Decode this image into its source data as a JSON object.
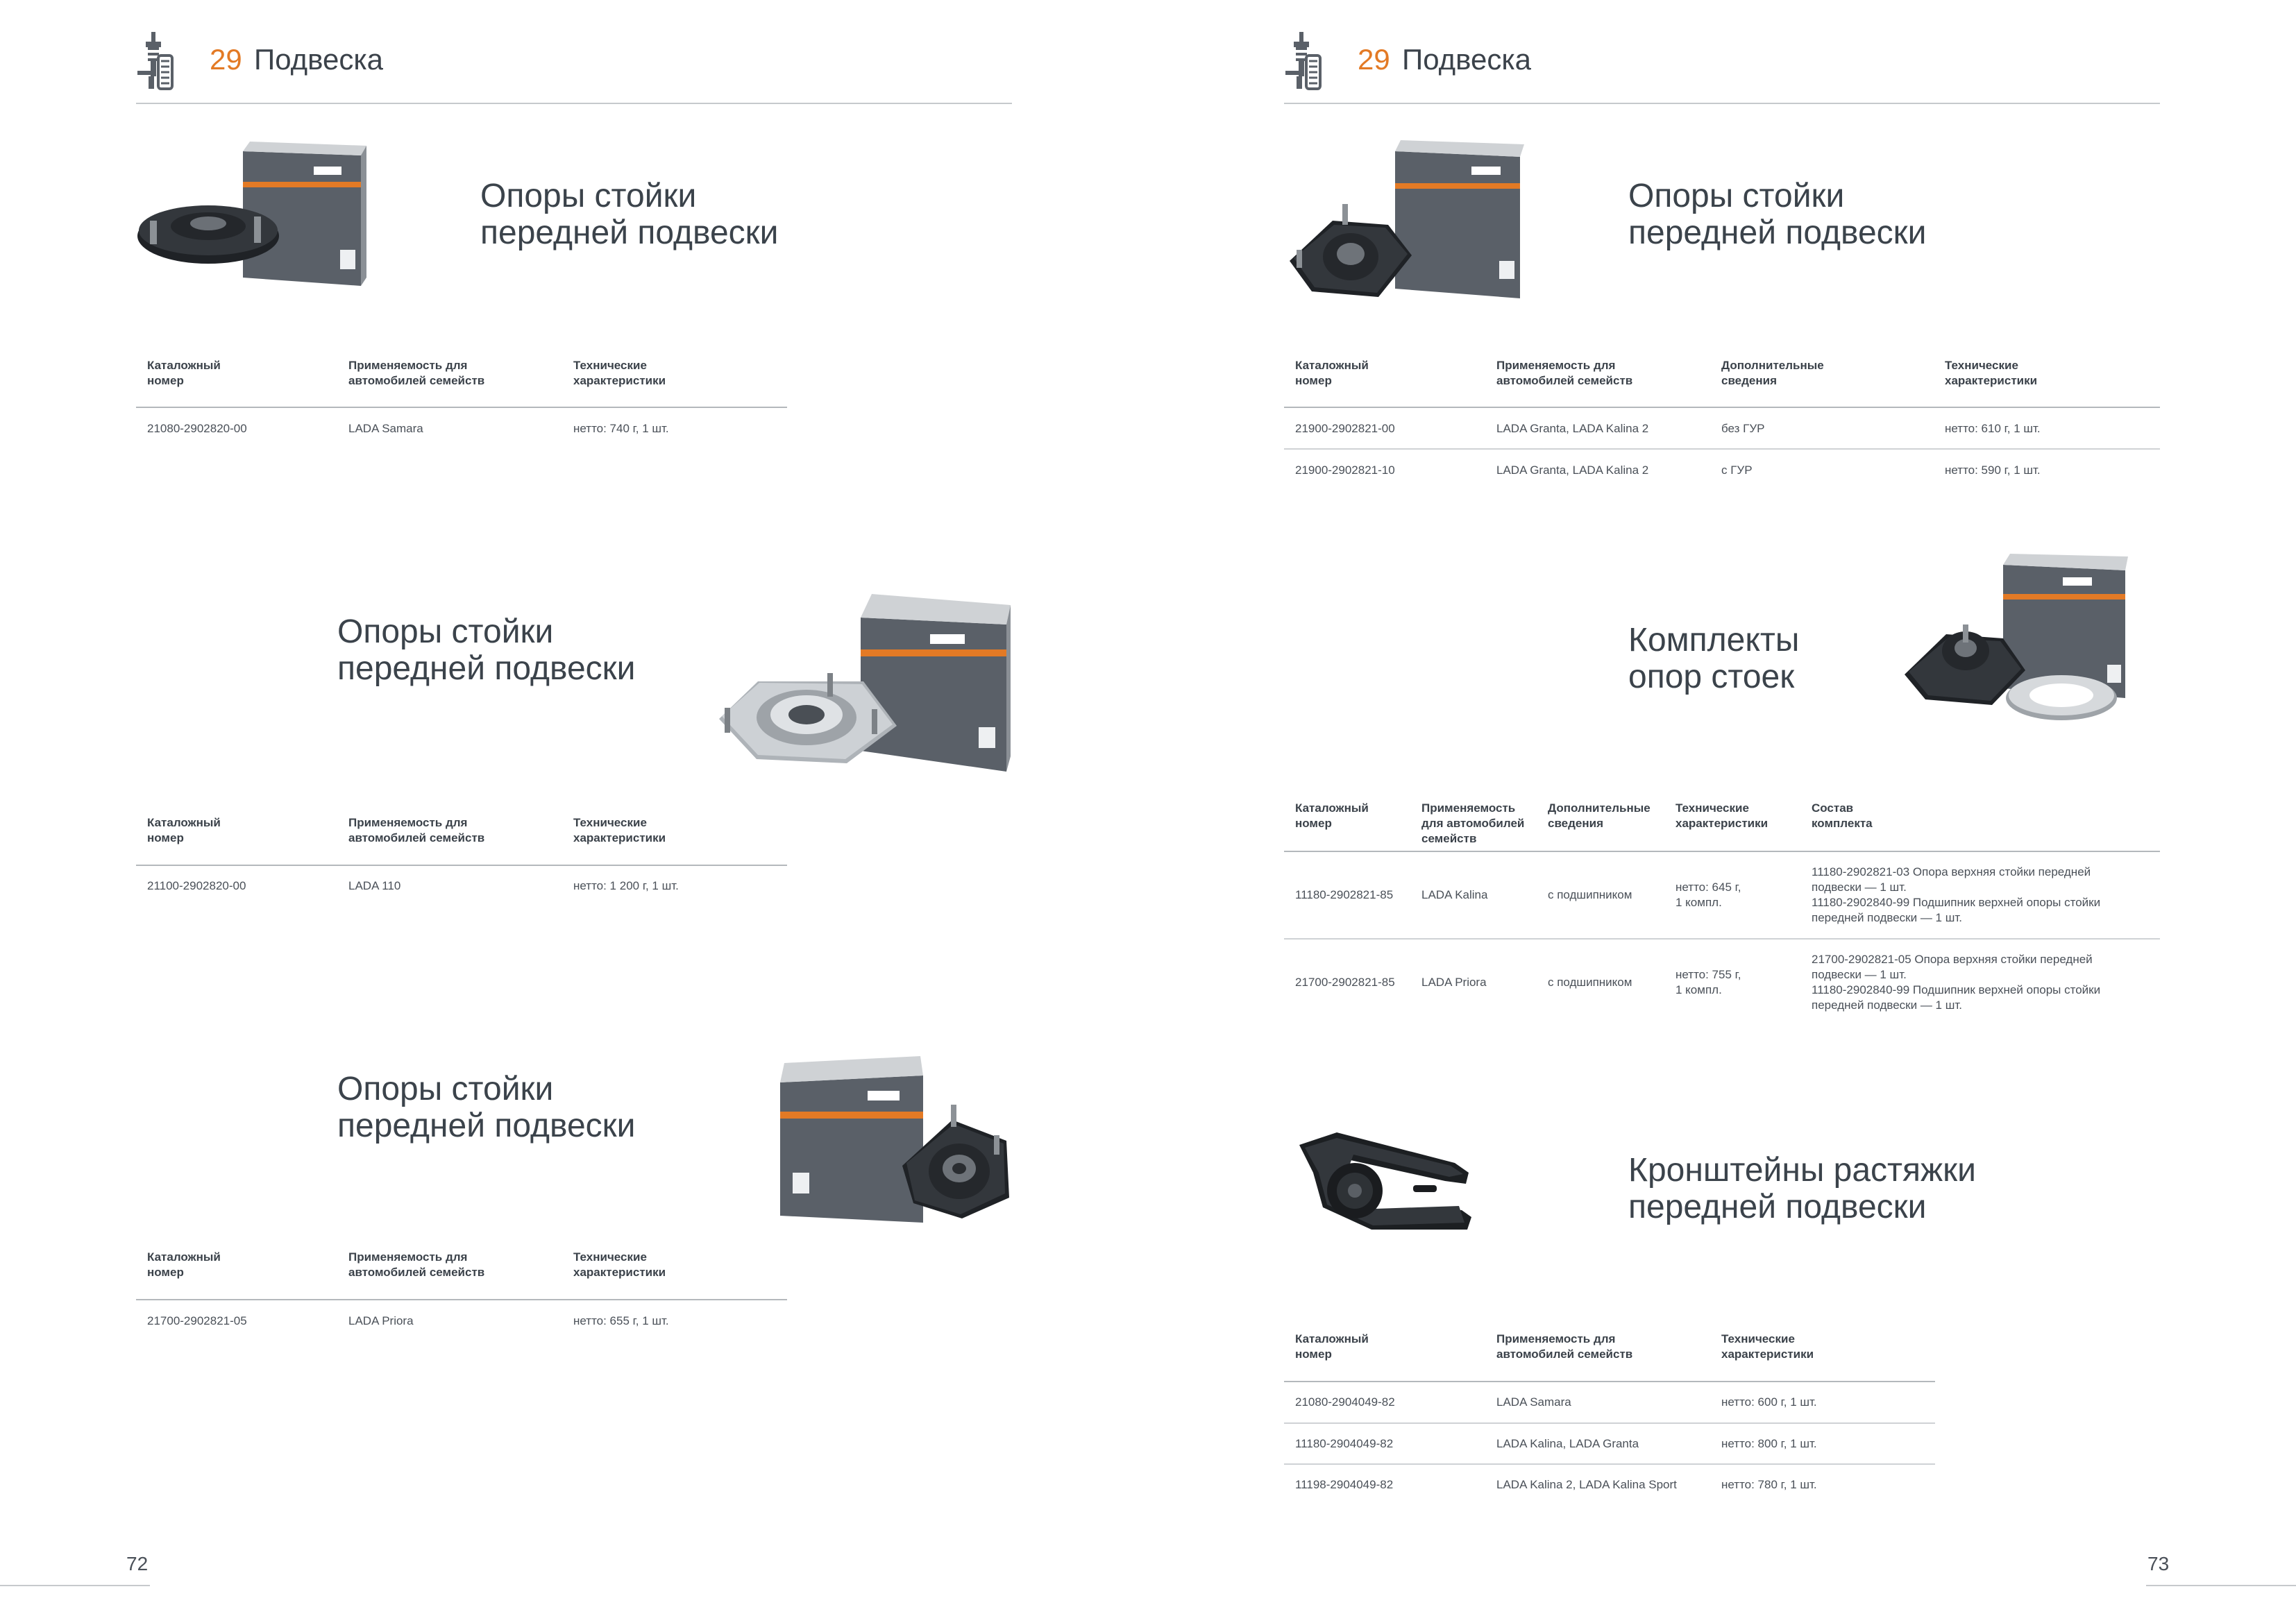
{
  "header": {
    "number": "29",
    "title": "Подвеска"
  },
  "left_page": {
    "page_number": "72",
    "sections": [
      {
        "title": "Опоры стойки\nпередней подвески",
        "columns": [
          "Каталожный\nномер",
          "Применяемость для\nавтомобилей семейств",
          "Технические\nхарактеристики"
        ],
        "rows": [
          [
            "21080-2902820-00",
            "LADA Samara",
            "нетто: 740 г, 1 шт."
          ]
        ]
      },
      {
        "title": "Опоры стойки\nпередней подвески",
        "columns": [
          "Каталожный\nномер",
          "Применяемость для\nавтомобилей семейств",
          "Технические\nхарактеристики"
        ],
        "rows": [
          [
            "21100-2902820-00",
            "LADA 110",
            "нетто: 1 200 г, 1 шт."
          ]
        ]
      },
      {
        "title": "Опоры стойки\nпередней подвески",
        "columns": [
          "Каталожный\nномер",
          "Применяемость для\nавтомобилей семейств",
          "Технические\nхарактеристики"
        ],
        "rows": [
          [
            "21700-2902821-05",
            "LADA Priora",
            "нетто: 655 г, 1 шт."
          ]
        ]
      }
    ]
  },
  "right_page": {
    "page_number": "73",
    "sections": [
      {
        "title": "Опоры стойки\nпередней подвески",
        "columns": [
          "Каталожный\nномер",
          "Применяемость для\nавтомобилей семейств",
          "Дополнительные\nсведения",
          "Технические\nхарактеристики"
        ],
        "rows": [
          [
            "21900-2902821-00",
            "LADA Granta, LADA Kalina 2",
            "без ГУР",
            "нетто: 610 г, 1 шт."
          ],
          [
            "21900-2902821-10",
            "LADA Granta, LADA Kalina 2",
            "с ГУР",
            "нетто: 590 г, 1 шт."
          ]
        ]
      },
      {
        "title": "Комплекты\nопор стоек",
        "columns": [
          "Каталожный\nномер",
          "Применяемость\nдля автомобилей\nсемейств",
          "Дополнительные\nсведения",
          "Технические\nхарактеристики",
          "Состав\nкомплекта"
        ],
        "rows": [
          [
            "11180-2902821-85",
            "LADA Kalina",
            "с подшипником",
            "нетто: 645 г,\n1 компл.",
            "11180-2902821-03 Опора верхняя стойки передней\nподвески — 1 шт.\n11180-2902840-99 Подшипник верхней опоры стойки\nпередней подвески — 1 шт."
          ],
          [
            "21700-2902821-85",
            "LADA Priora",
            "с подшипником",
            "нетто: 755 г,\n1 компл.",
            "21700-2902821-05 Опора верхняя стойки передней\nподвески — 1 шт.\n11180-2902840-99 Подшипник верхней опоры стойки\nпередней подвески — 1 шт."
          ]
        ]
      },
      {
        "title": "Кронштейны растяжки\nпередней подвески",
        "columns": [
          "Каталожный\nномер",
          "Применяемость для\nавтомобилей семейств",
          "Технические\nхарактеристики"
        ],
        "rows": [
          [
            "21080-2904049-82",
            "LADA Samara",
            "нетто: 600 г, 1 шт."
          ],
          [
            "11180-2904049-82",
            "LADA Kalina, LADA Granta",
            "нетто: 800 г, 1 шт."
          ],
          [
            "11198-2904049-82",
            "LADA Kalina 2, LADA Kalina Sport",
            "нетто: 780 г, 1 шт."
          ]
        ]
      }
    ]
  },
  "colors": {
    "accent": "#e37a25",
    "text": "#3b424a",
    "box_gray": "#5a6068",
    "box_light": "#d9dbdd",
    "part_dark": "#2a2d31"
  },
  "icons": [
    "suspension-icon",
    "strut-mount-product-image",
    "bracket-product-image"
  ]
}
